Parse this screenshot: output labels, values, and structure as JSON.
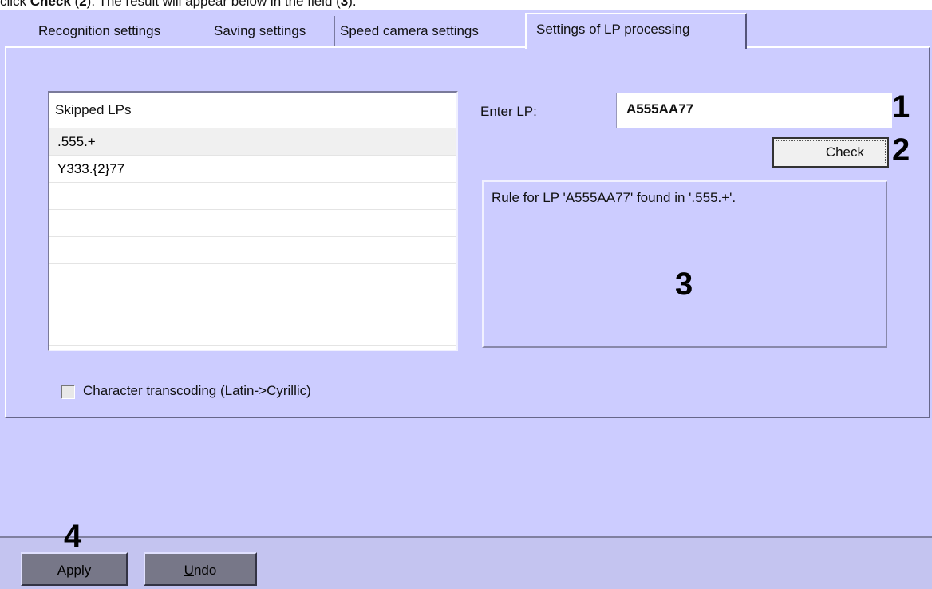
{
  "caption": {
    "prefix": "click ",
    "check": "Check",
    "mid1": " (",
    "num2": "2",
    "mid2": "). The result will appear below in the field (",
    "num3": "3",
    "suffix": ")."
  },
  "tabs": [
    {
      "label": "Recognition settings"
    },
    {
      "label": "Saving settings"
    },
    {
      "label": "Speed camera settings"
    },
    {
      "label": "Settings of LP processing"
    }
  ],
  "skipped_list": {
    "header": "Skipped LPs",
    "rows": [
      ".555.+",
      "Y333.{2}77",
      "",
      "",
      "",
      "",
      "",
      ""
    ]
  },
  "lp_check": {
    "label": "Enter LP:",
    "value": "A555AA77",
    "check_button": "Check",
    "result": "Rule for LP 'A555AA77' found in '.555.+'."
  },
  "transcoding_checkbox": {
    "label": "Character transcoding (Latin->Cyrillic)",
    "checked": false
  },
  "footer": {
    "apply": "Apply",
    "undo_u": "U",
    "undo_rest": "ndo"
  },
  "markers": {
    "m1": "1",
    "m2": "2",
    "m3": "3",
    "m4": "4"
  }
}
